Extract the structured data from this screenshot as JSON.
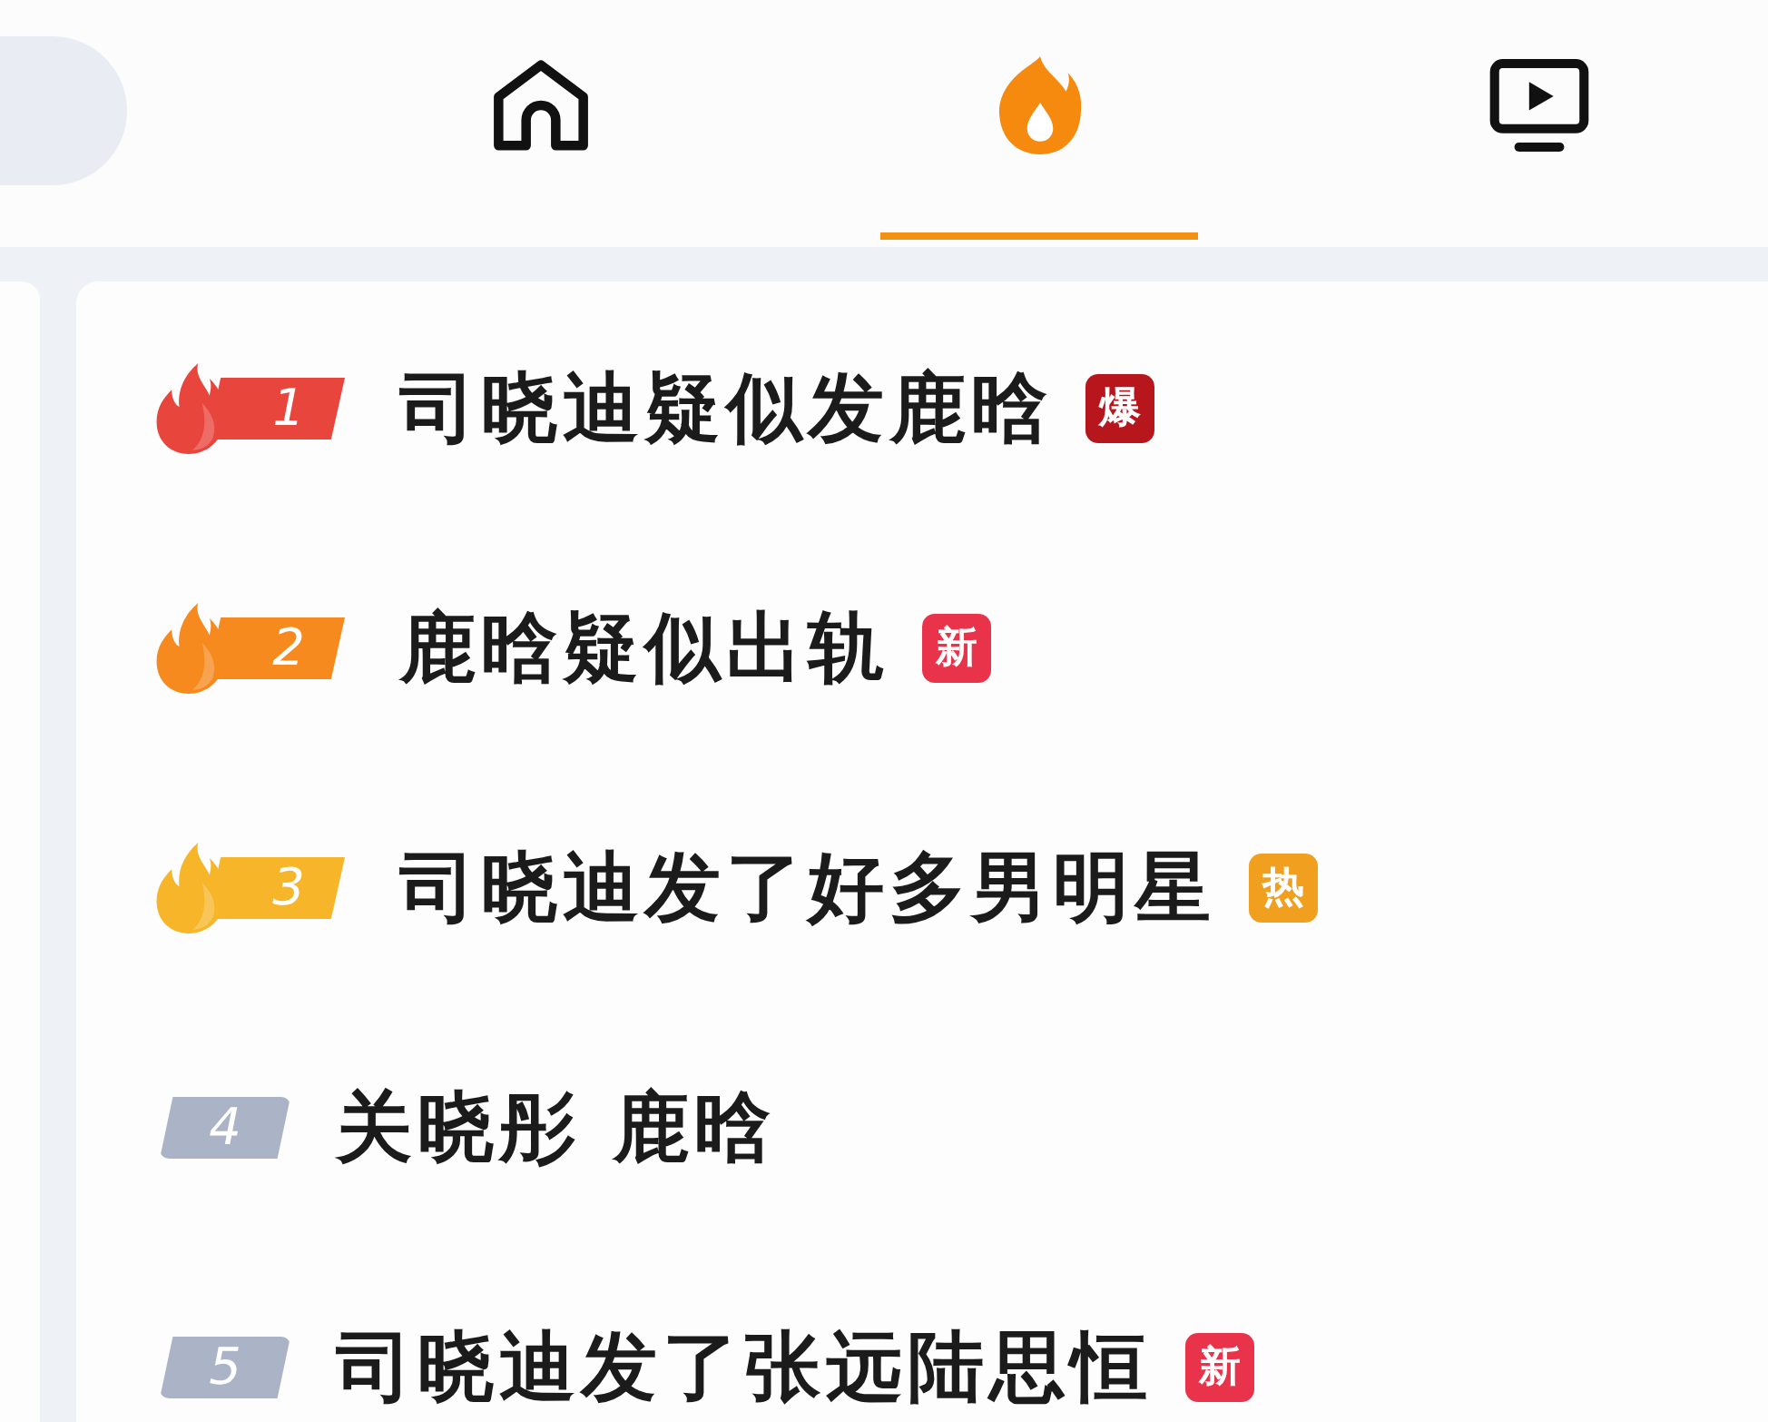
{
  "tabs": [
    {
      "kind": "home",
      "selected": false
    },
    {
      "kind": "hot",
      "selected": true
    },
    {
      "kind": "video",
      "selected": false
    }
  ],
  "rows": [
    {
      "rank": {
        "text": "1",
        "kind": "flame",
        "color": "#e8453c"
      },
      "title": "司晓迪疑似发鹿晗",
      "tag": {
        "text": "爆",
        "color": "#b8161d"
      }
    },
    {
      "rank": {
        "text": "2",
        "kind": "flame",
        "color": "#f68a1e"
      },
      "title": "鹿晗疑似出轨",
      "tag": {
        "text": "新",
        "color": "#e8334b"
      }
    },
    {
      "rank": {
        "text": "3",
        "kind": "flame",
        "color": "#f7b52a"
      },
      "title": "司晓迪发了好多男明星",
      "tag": {
        "text": "热",
        "color": "#f0a01e"
      }
    },
    {
      "rank": {
        "text": "4",
        "kind": "plain",
        "color": "#aab4c6"
      },
      "title": "关晓彤 鹿晗"
    },
    {
      "rank": {
        "text": "5",
        "kind": "plain",
        "color": "#aab4c6"
      },
      "title": "司晓迪发了张远陆思恒",
      "tag": {
        "text": "新",
        "color": "#e8334b"
      }
    }
  ]
}
